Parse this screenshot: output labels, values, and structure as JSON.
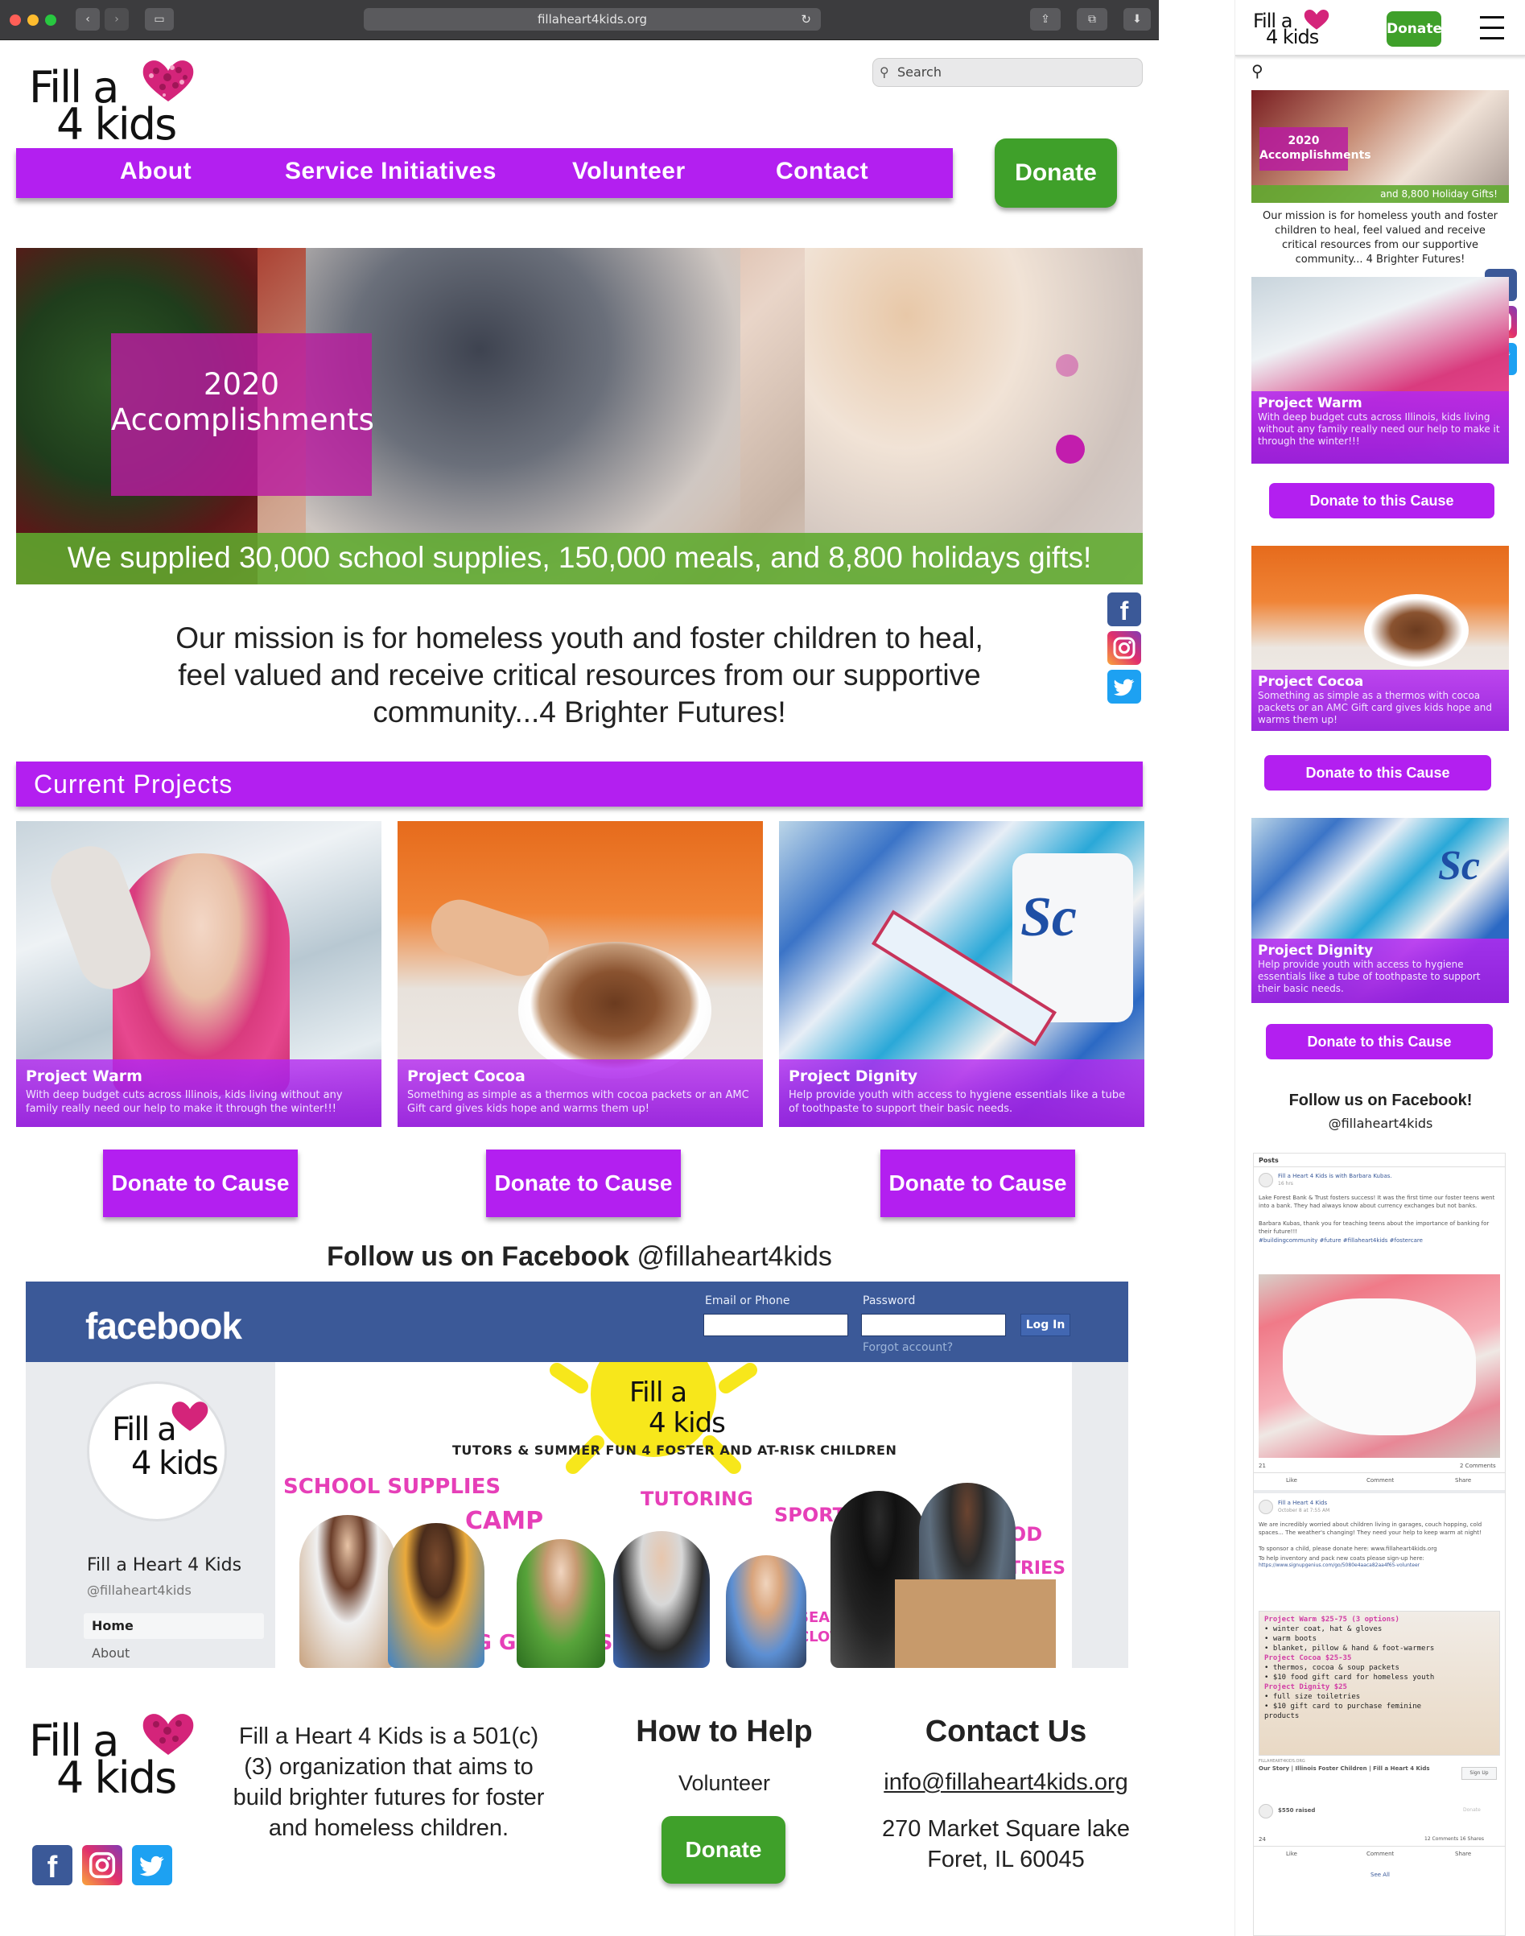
{
  "browser": {
    "url": "fillaheart4kids.org",
    "nav_back": "‹",
    "nav_forward": "›",
    "reload_icon": "↻",
    "share_icon": "⇪",
    "tabs_icon": "⧉",
    "download_icon": "⬇"
  },
  "site": {
    "logo": {
      "line1": "Fill a",
      "line2": "4 kids"
    },
    "search_placeholder": "Search",
    "nav": [
      "About",
      "Service Initiatives",
      "Volunteer",
      "Contact"
    ],
    "donate": "Donate",
    "hero": {
      "title_line1": "2020",
      "title_line2": "Accomplishments",
      "caption": "We supplied 30,000 school supplies, 150,000 meals, and 8,800 holidays gifts!"
    },
    "mission": "Our mission is for homeless youth and foster children to heal, feel valued and receive critical resources from our supportive community...4 Brighter Futures!",
    "current_projects_title": "Current Projects",
    "projects": [
      {
        "title": "Project Warm",
        "desc": "With deep budget cuts across Illinois, kids living without any family really need our help to make it through the winter!!!",
        "button": "Donate to Cause"
      },
      {
        "title": "Project Cocoa",
        "desc": "Something as simple as a thermos with cocoa packets or an AMC Gift card gives kids hope and warms them up!",
        "button": "Donate to Cause"
      },
      {
        "title": "Project Dignity",
        "desc": "Help provide youth with access to hygiene essentials like a tube of toothpaste to support their basic needs.",
        "button": "Donate to Cause"
      }
    ],
    "follow": {
      "bold": "Follow us on Facebook",
      "handle": "@fillaheart4kids"
    },
    "facebook_embed": {
      "brand": "facebook",
      "email_label": "Email or Phone",
      "password_label": "Password",
      "login": "Log In",
      "forgot": "Forgot account?",
      "page_name": "Fill a Heart 4 Kids",
      "page_handle": "@fillaheart4kids",
      "menu": [
        "Home",
        "About"
      ],
      "cover": {
        "headline": "TUTORS & SUMMER FUN 4 FOSTER AND AT-RISK CHILDREN",
        "labels": [
          "SCHOOL SUPPLIES",
          "CAMP",
          "TUTORING",
          "SPORTS",
          "FOOD",
          "TOILETRIES",
          "SEASONAL CLOTHING",
          "HEALING GARDENS"
        ]
      }
    },
    "footer": {
      "about": "Fill a Heart 4 Kids is a 501(c)(3) organization that aims to build brighter futures for foster and homeless children.",
      "help_title": "How to Help",
      "help_link": "Volunteer",
      "help_donate": "Donate",
      "contact_title": "Contact Us",
      "email": "info@fillaheart4kids.org",
      "address_line1": "270 Market Square lake",
      "address_line2": "Foret, IL 60045"
    }
  },
  "mobile": {
    "donate": "Donate",
    "menu_icon": "hamburger-icon",
    "hero_title": "2020 Accomplishments",
    "hero_sub": "and 8,800 Holiday Gifts!",
    "mission": "Our mission is for homeless youth and foster children to heal, feel valued and receive critical resources from our supportive community... 4 Brighter Futures!",
    "projects": [
      {
        "title": "Project Warm",
        "desc": "With deep budget cuts across Illinois, kids living without any family really need our help to make it through the winter!!!",
        "button": "Donate to this Cause"
      },
      {
        "title": "Project Cocoa",
        "desc": "Something as simple as a thermos with cocoa packets or an AMC Gift card gives kids hope and warms them up!",
        "button": "Donate to this Cause"
      },
      {
        "title": "Project Dignity",
        "desc": "Help provide youth with access to hygiene essentials like a tube of toothpaste to support their basic needs.",
        "button": "Donate to this Cause"
      }
    ],
    "follow_title": "Follow us on Facebook!",
    "follow_handle": "@fillaheart4kids",
    "feed": {
      "tab": "Posts",
      "post1_author": "Fill a Heart 4 Kids is with Barbara Kubas.",
      "post1_time": "16 hrs",
      "post1_text": "Lake Forest Bank & Trust fosters success! It was the first time our foster teens went into a bank. They had always know about currency exchanges but not banks.",
      "post1_text2": "Barbara Kubas, thank you for teaching teens about the importance of banking for their future!!!",
      "post1_tags": "#buildingcommunity #future #fillaheart4kids #fostercare",
      "post1_reactions": "21",
      "post1_comments": "2 Comments",
      "actions": [
        "Like",
        "Comment",
        "Share"
      ],
      "post2_author": "Fill a Heart 4 Kids",
      "post2_time": "October 8 at 7:55 AM",
      "post2_text": "We are incredibly worried about children living in garages, couch hopping, cold spaces... The weather's changing! They need your help to keep warm at night!",
      "post2_text2": "To sponsor a child, please donate here: www.fillaheart4kids.org",
      "post2_text3": "To help inventory and pack new coats please sign-up here:",
      "post2_link": "https://www.signupgenius.com/go/5080e4aaca82aa4f65-volunteer",
      "flyer_lines": [
        "Project Warm $25-75 (3 options)",
        "• winter coat, hat & gloves",
        "• warm boots",
        "• blanket, pillow & hand & foot-warmers",
        "Project Cocoa $25-35",
        "• thermos, cocoa & soup packets",
        "• $10 food gift card for homeless youth",
        "Project Dignity $25",
        "• full size toiletries",
        "• $10 gift card to purchase feminine",
        "products"
      ],
      "card_domain": "FILLAHEART4KIDS.ORG",
      "card_title": "Our Story | Illinois Foster Children | Fill a Heart 4 Kids",
      "card_btn": "Sign Up",
      "raised": "$550 raised",
      "raised_btn": "Donate",
      "post2_reactions": "24",
      "post2_meta": "12 Comments  16 Shares",
      "see_all": "See All"
    }
  },
  "colors": {
    "purple": "#b31ff0",
    "green": "#3fa02a",
    "magenta": "#c21dad",
    "facebook_blue": "#3b5998"
  }
}
